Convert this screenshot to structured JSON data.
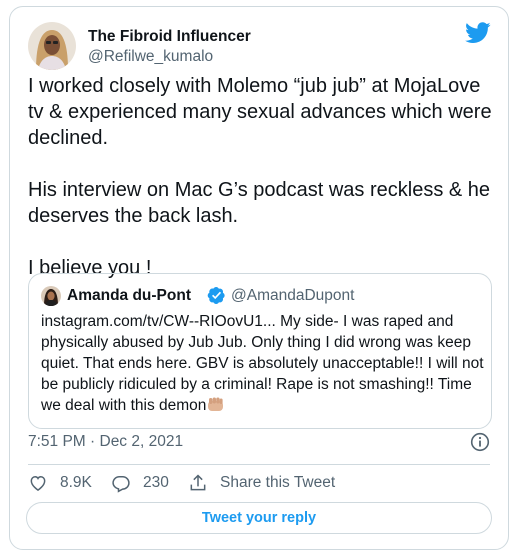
{
  "colors": {
    "accent": "#1d9bf0",
    "muted": "#536471",
    "border": "#cfd9de",
    "text": "#0f1419"
  },
  "author": {
    "name": "The Fibroid Influencer",
    "handle": "@Refilwe_kumalo",
    "avatar_icon": "profile-photo"
  },
  "logo_icon": "twitter-bird-icon",
  "tweet": {
    "paragraphs": [
      "I worked closely with Molemo “jub jub” at MojaLove tv & experienced many sexual advances which were declined.",
      "His interview on Mac G’s podcast was reckless & he deserves the back lash.",
      "I believe you !"
    ]
  },
  "quote": {
    "name": "Amanda du-Pont",
    "verified": true,
    "handle": "@AmandaDupont",
    "text": "instagram.com/tv/CW--RIOovU1... My side- I was raped and physically abused by Jub Jub. Only thing I did wrong was keep quiet. That ends here. GBV is absolutely unacceptable!! I will not be publicly ridiculed by a criminal! Rape is not smashing!! Time we deal with this demon",
    "emoji_icon": "raised-fist-emoji"
  },
  "timestamp": "7:51 PM · Dec 2, 2021",
  "actions": {
    "likes": "8.9K",
    "replies": "230",
    "share": "Share this Tweet"
  },
  "reply_button": "Tweet your reply"
}
